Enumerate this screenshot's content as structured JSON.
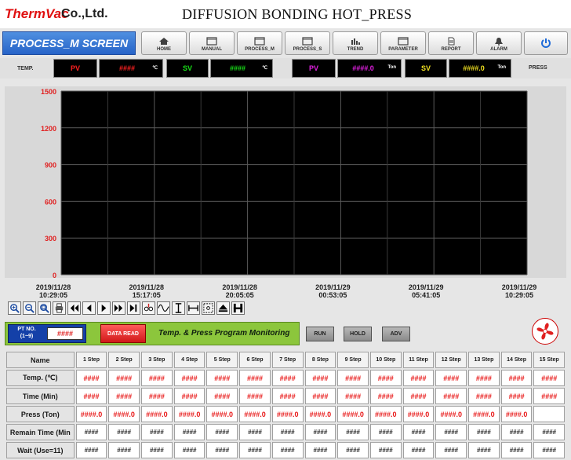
{
  "header": {
    "logo_primary": "ThermVac",
    "logo_secondary": "Co.,Ltd.",
    "title": "DIFFUSION BONDING HOT_PRESS"
  },
  "nav": {
    "screen_label": "PROCESS_M SCREEN",
    "buttons": [
      {
        "label": "HOME",
        "icon": "home-icon"
      },
      {
        "label": "MANUAL",
        "icon": "window-icon"
      },
      {
        "label": "PROCESS_M",
        "icon": "window-icon"
      },
      {
        "label": "PROCESS_S",
        "icon": "window-icon"
      },
      {
        "label": "TREND",
        "icon": "bar-chart-icon"
      },
      {
        "label": "PARAMETER",
        "icon": "window-icon"
      },
      {
        "label": "REPORT",
        "icon": "document-icon"
      },
      {
        "label": "ALARM",
        "icon": "bell-icon"
      }
    ],
    "power_icon": "power-icon"
  },
  "readouts": {
    "temp_label": "TEMP.",
    "press_label": "PRESS",
    "temp_pv": {
      "label": "PV",
      "value": "####",
      "unit": "℃"
    },
    "temp_sv": {
      "label": "SV",
      "value": "####",
      "unit": "℃"
    },
    "press_pv": {
      "label": "PV",
      "value": "####.0",
      "unit": "Ton"
    },
    "press_sv": {
      "label": "SV",
      "value": "####.0",
      "unit": "Ton"
    },
    "colors": {
      "pv": "#ff2020",
      "sv": "#18e018",
      "press_pv": "#e020e0",
      "press_sv": "#f0e020"
    }
  },
  "chart_data": {
    "type": "line",
    "series": [],
    "y_ticks": [
      0,
      300,
      600,
      900,
      1200,
      1500
    ],
    "ylim": [
      0,
      1500
    ],
    "x_ticks": [
      {
        "date": "2019/11/28",
        "time": "10:29:05"
      },
      {
        "date": "2019/11/28",
        "time": "15:17:05"
      },
      {
        "date": "2019/11/28",
        "time": "20:05:05"
      },
      {
        "date": "2019/11/29",
        "time": "00:53:05"
      },
      {
        "date": "2019/11/29",
        "time": "05:41:05"
      },
      {
        "date": "2019/11/29",
        "time": "10:29:05"
      }
    ],
    "grid": true,
    "background": "#000000",
    "tick_color": "#e02020"
  },
  "toolbar": {
    "icons": [
      "zoom-in-icon",
      "zoom-out-icon",
      "zoom-reset-icon",
      "print-icon",
      "first-icon",
      "previous-icon",
      "play-icon",
      "next-icon",
      "last-icon",
      "trend-add-icon",
      "wave-icon",
      "vertical-scale-icon",
      "horizontal-scale-icon",
      "select-area-icon",
      "eject-icon",
      "hold-icon"
    ]
  },
  "program": {
    "pt_label_line1": "PT NO.",
    "pt_label_line2": "(1~9)",
    "pt_value": "####",
    "data_read": "DATA READ",
    "title": "Temp. & Press Program Monitoring",
    "run": "RUN",
    "hold": "HOLD",
    "adv": "ADV",
    "fan_icon": "fan-icon"
  },
  "table": {
    "rows": [
      {
        "name": "Name",
        "cells": [
          "1 Step",
          "2 Step",
          "3 Step",
          "4 Step",
          "5 Step",
          "6 Step",
          "7 Step",
          "8 Step",
          "9 Step",
          "10 Step",
          "11 Step",
          "12 Step",
          "13 Step",
          "14 Step",
          "15 Step"
        ]
      },
      {
        "name": "Temp. (℃)",
        "cells": [
          "####",
          "####",
          "####",
          "####",
          "####",
          "####",
          "####",
          "####",
          "####",
          "####",
          "####",
          "####",
          "####",
          "####",
          "####"
        ]
      },
      {
        "name": "Time (Min)",
        "cells": [
          "####",
          "####",
          "####",
          "####",
          "####",
          "####",
          "####",
          "####",
          "####",
          "####",
          "####",
          "####",
          "####",
          "####",
          "####"
        ]
      },
      {
        "name": "Press (Ton)",
        "cells": [
          "####.0",
          "####.0",
          "####.0",
          "####.0",
          "####.0",
          "####.0",
          "####.0",
          "####.0",
          "####.0",
          "####.0",
          "####.0",
          "####.0",
          "####.0",
          "####.0",
          ""
        ]
      },
      {
        "name": "Remain Time (Min",
        "cells": [
          "####",
          "####",
          "####",
          "####",
          "####",
          "####",
          "####",
          "####",
          "####",
          "####",
          "####",
          "####",
          "####",
          "####",
          "####"
        ]
      },
      {
        "name": "Wait (Use=11)",
        "cells": [
          "####",
          "####",
          "####",
          "####",
          "####",
          "####",
          "####",
          "####",
          "####",
          "####",
          "####",
          "####",
          "####",
          "####",
          "####"
        ]
      }
    ]
  }
}
